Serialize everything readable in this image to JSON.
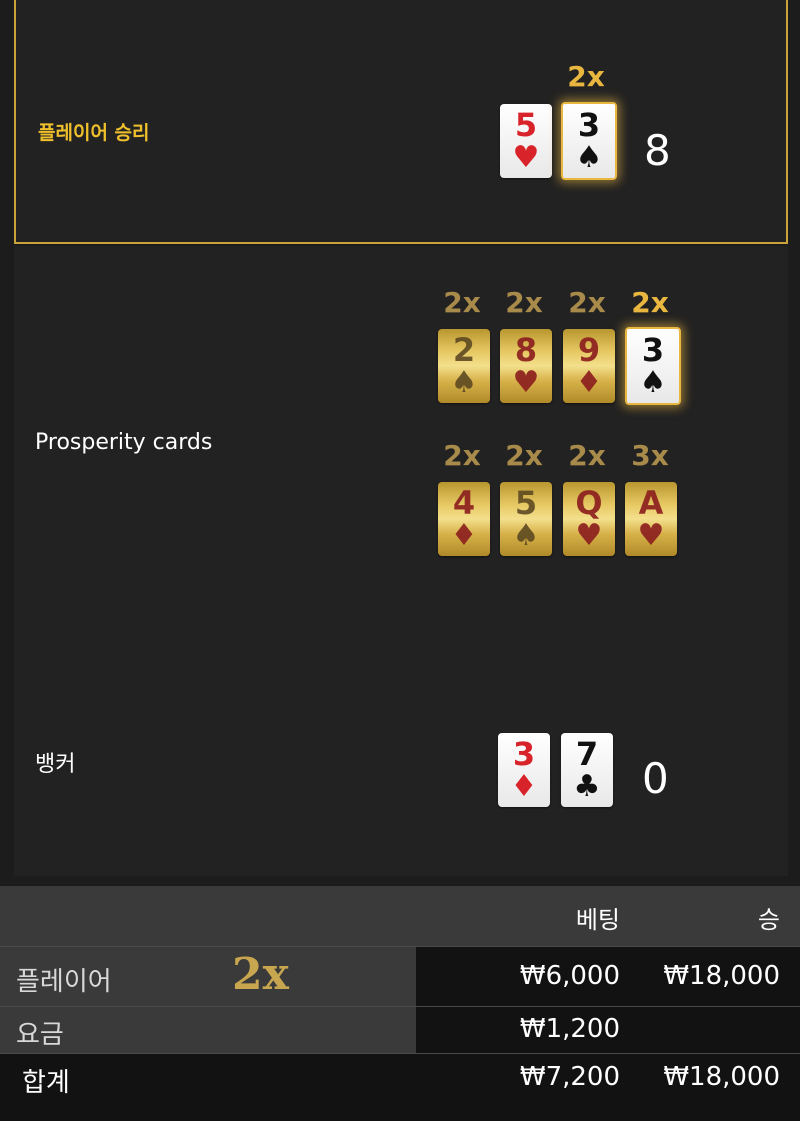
{
  "player": {
    "label": "플레이어 승리",
    "multiplier": "2x",
    "score": "8",
    "cards": [
      {
        "rank": "5",
        "suit": "♥",
        "color": "red"
      },
      {
        "rank": "3",
        "suit": "♠",
        "color": "black"
      }
    ]
  },
  "prosperity": {
    "label": "Prosperity cards",
    "cards": [
      {
        "rank": "2",
        "suit": "♠",
        "color": "black",
        "mult": "2x"
      },
      {
        "rank": "8",
        "suit": "♥",
        "color": "red",
        "mult": "2x"
      },
      {
        "rank": "9",
        "suit": "♦",
        "color": "red",
        "mult": "2x"
      },
      {
        "rank": "3",
        "suit": "♠",
        "color": "black",
        "mult": "2x"
      },
      {
        "rank": "4",
        "suit": "♦",
        "color": "red",
        "mult": "2x"
      },
      {
        "rank": "5",
        "suit": "♠",
        "color": "black",
        "mult": "2x"
      },
      {
        "rank": "Q",
        "suit": "♥",
        "color": "red",
        "mult": "2x"
      },
      {
        "rank": "A",
        "suit": "♥",
        "color": "red",
        "mult": "3x"
      }
    ]
  },
  "banker": {
    "label": "뱅커",
    "score": "0",
    "cards": [
      {
        "rank": "3",
        "suit": "♦",
        "color": "red"
      },
      {
        "rank": "7",
        "suit": "♣",
        "color": "black"
      }
    ]
  },
  "table": {
    "col_bet": "베팅",
    "col_win": "승",
    "rows": [
      {
        "name": "플레이어",
        "mult": "2x",
        "bet": "₩6,000",
        "win": "₩18,000"
      },
      {
        "name": "요금",
        "bet": "₩1,200",
        "win": ""
      },
      {
        "name": "합계",
        "bet": "₩7,200",
        "win": "₩18,000"
      }
    ]
  },
  "colors": {
    "accent_gold": "#e9b640",
    "border_gold": "#c9a23a",
    "label_gold": "#f0c02c"
  }
}
